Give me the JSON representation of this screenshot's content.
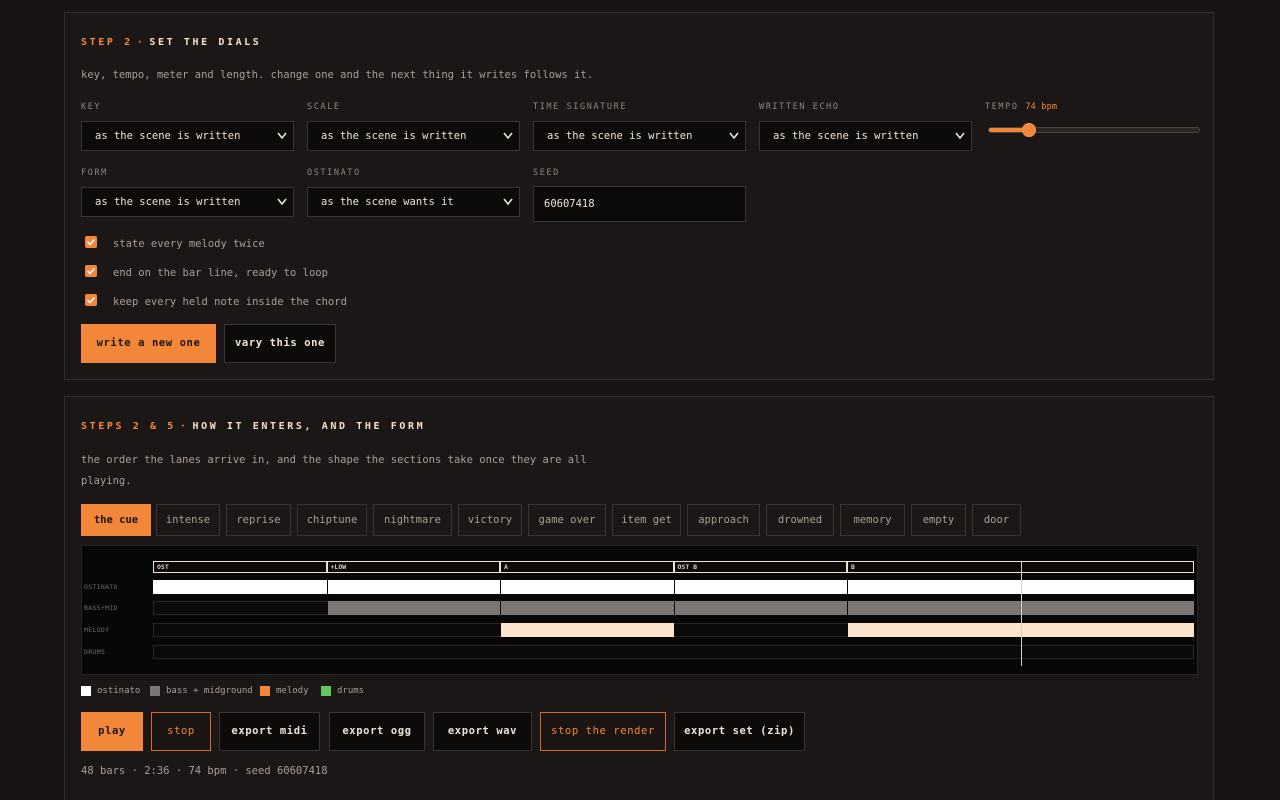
{
  "dials": {
    "heading_step": "STEP 2",
    "heading_dot": "·",
    "heading_title": "SET THE DIALS",
    "description": "key, tempo, meter and length. change one and the next thing it writes follows it.",
    "key": {
      "label": "KEY",
      "value": "as the scene is written"
    },
    "scale": {
      "label": "SCALE",
      "value": "as the scene is written"
    },
    "time_signature": {
      "label": "TIME SIGNATURE",
      "value": "as the scene is written"
    },
    "written_echo": {
      "label": "WRITTEN ECHO",
      "value": "as the scene is written"
    },
    "tempo": {
      "label": "TEMPO",
      "value_text": "74 bpm",
      "min": 40,
      "max": 240,
      "value": 74
    },
    "form": {
      "label": "FORM",
      "value": "as the scene is written"
    },
    "ostinato": {
      "label": "OSTINATO",
      "value": "as the scene wants it"
    },
    "seed": {
      "label": "SEED",
      "value": "60607418"
    },
    "checkboxes": [
      {
        "label": "state every melody twice",
        "checked": true
      },
      {
        "label": "end on the bar line, ready to loop",
        "checked": true
      },
      {
        "label": "keep every held note inside the chord",
        "checked": true
      }
    ],
    "write_new_label": "write a new one",
    "vary_label": "vary this one"
  },
  "form_section": {
    "heading_step": "STEPS 2 & 5",
    "heading_dot": "·",
    "heading_title": "HOW IT ENTERS, AND THE FORM",
    "description_line1": "the order the lanes arrive in, and the shape the sections take once they are all",
    "description_line2": "playing.",
    "tabs": [
      "the cue",
      "intense",
      "reprise",
      "chiptune",
      "nightmare",
      "victory",
      "game over",
      "item get",
      "approach",
      "drowned",
      "memory",
      "empty",
      "door"
    ],
    "active_tab": "the cue"
  },
  "timeline": {
    "total_bars": 48,
    "playhead_bar": 40,
    "sections": [
      {
        "label": "OST",
        "start": 0,
        "end": 8
      },
      {
        "label": "+LOW",
        "start": 8,
        "end": 16
      },
      {
        "label": "A",
        "start": 16,
        "end": 24
      },
      {
        "label": "OST B",
        "start": 24,
        "end": 32
      },
      {
        "label": "B",
        "start": 32,
        "end": 48
      }
    ],
    "lanes": [
      {
        "label": "OSTINATO",
        "color": "#ffffff",
        "segments": [
          [
            0,
            8
          ],
          [
            8,
            16
          ],
          [
            16,
            24
          ],
          [
            24,
            32
          ],
          [
            32,
            48
          ]
        ]
      },
      {
        "label": "BASS+MID",
        "color": "#7a7673",
        "segments": [
          [
            8,
            16
          ],
          [
            16,
            24
          ],
          [
            24,
            32
          ],
          [
            32,
            48
          ]
        ]
      },
      {
        "label": "MELODY",
        "color": "#fbe3cc",
        "segments": [
          [
            16,
            24
          ],
          [
            32,
            48
          ]
        ]
      },
      {
        "label": "DRUMS",
        "color": "#5ec85e",
        "segments": []
      }
    ]
  },
  "legend": [
    {
      "label": "ostinato",
      "color": "#ffffff"
    },
    {
      "label": "bass + midground",
      "color": "#7a7673"
    },
    {
      "label": "melody",
      "color": "#f2873a"
    },
    {
      "label": "drums",
      "color": "#5ec85e"
    }
  ],
  "transport": {
    "play": "play",
    "stop": "stop",
    "export_midi": "export midi",
    "export_ogg": "export ogg",
    "export_wav": "export wav",
    "stop_render": "stop the render",
    "export_set": "export set (zip)"
  },
  "status_line": "48 bars · 2:36 · 74 bpm · seed 60607418",
  "colors": {
    "accent": "#f2873a",
    "background": "#161312",
    "panel": "#1b1716"
  }
}
